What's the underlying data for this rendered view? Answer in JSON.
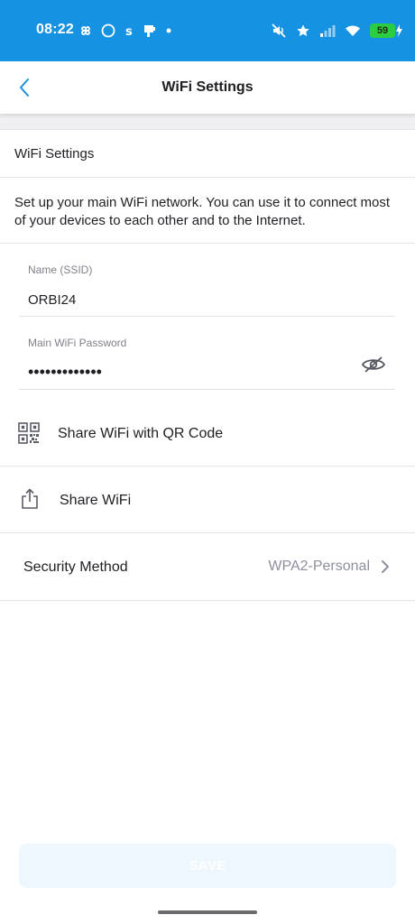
{
  "status_bar": {
    "time": "08:22",
    "battery": "59",
    "background_color": "#1592e2"
  },
  "header": {
    "title": "WiFi Settings",
    "back_icon": "chevron-left-icon",
    "accent_color": "#1a8fe0"
  },
  "section": {
    "title": "WiFi Settings",
    "description": "Set up your main WiFi network. You can use it to connect most of your devices to each other and to the Internet."
  },
  "fields": {
    "ssid": {
      "label": "Name (SSID)",
      "value": "ORBI24"
    },
    "password": {
      "label": "Main WiFi Password",
      "value": "•••••••••••••",
      "toggle_icon": "eye-off-icon"
    }
  },
  "actions": {
    "share_qr": {
      "label": "Share WiFi with QR Code",
      "icon": "qr-code-icon"
    },
    "share_wifi": {
      "label": "Share WiFi",
      "icon": "share-icon"
    },
    "security": {
      "label": "Security Method",
      "value": "WPA2-Personal",
      "icon": "chevron-right-icon"
    }
  },
  "footer": {
    "save_label": "SAVE"
  }
}
